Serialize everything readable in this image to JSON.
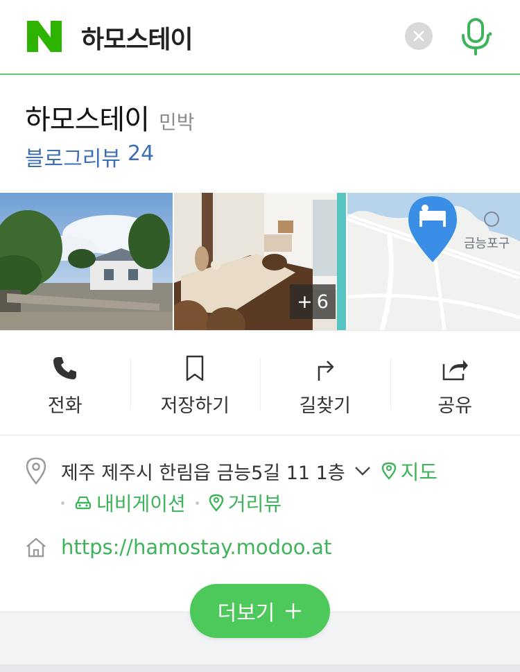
{
  "search": {
    "query": "하모스테이",
    "logo_letter": "N",
    "accent": "#5ccb71"
  },
  "place": {
    "name": "하모스테이",
    "category": "민박",
    "blog_review_label": "블로그리뷰",
    "blog_review_count": "24"
  },
  "photos": {
    "more_count": "6",
    "more_prefix": "+"
  },
  "actions": [
    {
      "label": "전화",
      "icon": "phone-icon"
    },
    {
      "label": "저장하기",
      "icon": "bookmark-icon"
    },
    {
      "label": "길찾기",
      "icon": "directions-icon"
    },
    {
      "label": "공유",
      "icon": "share-icon"
    }
  ],
  "info": {
    "address": "제주 제주시 한림읍 금능5길 11 1층",
    "map_label": "지도",
    "navigation_label": "내비게이션",
    "street_view_label": "거리뷰",
    "homepage": "https://hamostay.modoo.at"
  },
  "more_button": {
    "label": "더보기",
    "suffix": "+"
  },
  "map_thumbnail": {
    "label": "금능포구"
  }
}
